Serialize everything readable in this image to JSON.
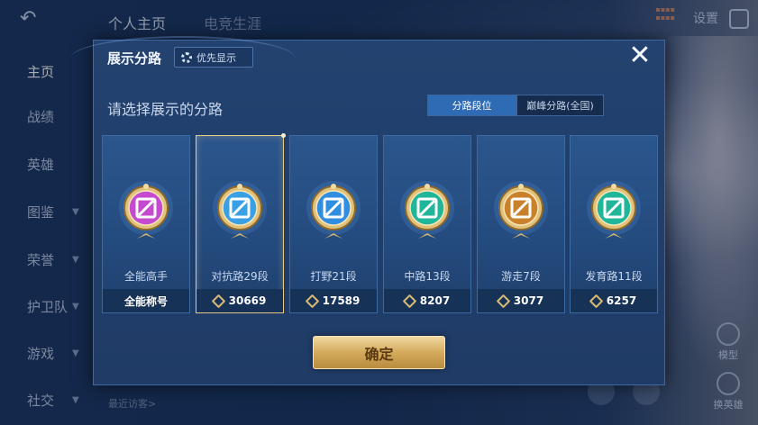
{
  "top_nav": {
    "tabs": [
      "个人主页",
      "电竞生涯"
    ],
    "settings_label": "设置"
  },
  "side_nav": {
    "items": [
      "主页",
      "战绩",
      "英雄",
      "图鉴",
      "荣誉",
      "护卫队",
      "游戏",
      "社交"
    ]
  },
  "visitors_label": "最近访客>",
  "right_actions": [
    "模型",
    "换英雄"
  ],
  "dialog": {
    "title": "展示分路",
    "priority_label": "优先显示",
    "prompt": "请选择展示的分路",
    "segments": [
      "分路段位",
      "巅峰分路(全国)"
    ],
    "active_segment_index": 0,
    "confirm_label": "确定",
    "lanes": [
      {
        "name": "全能高手",
        "value": "全能称号",
        "has_score_icon": false,
        "selected": false,
        "badge_color": "#c44bd0",
        "icon": "all-round-icon"
      },
      {
        "name": "对抗路29段",
        "value": "30669",
        "has_score_icon": true,
        "selected": true,
        "badge_color": "#3aa0e6",
        "icon": "clash-lane-icon"
      },
      {
        "name": "打野21段",
        "value": "17589",
        "has_score_icon": true,
        "selected": false,
        "badge_color": "#2f8ee0",
        "icon": "jungle-dragon-icon"
      },
      {
        "name": "中路13段",
        "value": "8207",
        "has_score_icon": true,
        "selected": false,
        "badge_color": "#1fb69a",
        "icon": "mid-lane-icon"
      },
      {
        "name": "游走7段",
        "value": "3077",
        "has_score_icon": true,
        "selected": false,
        "badge_color": "#c9822b",
        "icon": "roam-icon"
      },
      {
        "name": "发育路11段",
        "value": "6257",
        "has_score_icon": true,
        "selected": false,
        "badge_color": "#1fb69a",
        "icon": "farm-lane-icon"
      }
    ]
  }
}
